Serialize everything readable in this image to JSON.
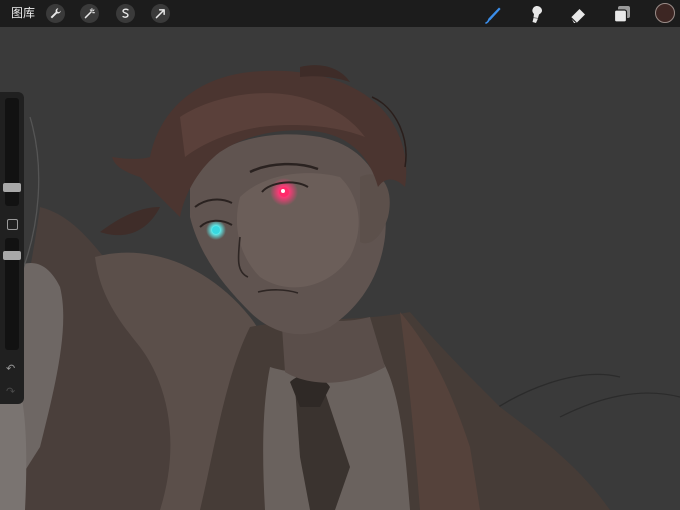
{
  "topbar": {
    "gallery_label": "图库",
    "left_tools": [
      "wrench-icon",
      "magic-wand-icon",
      "selection-icon",
      "transform-arrow-icon"
    ],
    "right_tools": [
      "brush-icon",
      "smudge-icon",
      "eraser-icon",
      "layers-icon",
      "color-swatch"
    ],
    "active_tool": "brush-icon",
    "accent_color": "#3b8eea",
    "current_color": "#3d2623"
  },
  "sidebar": {
    "brush_size_level": 0.55,
    "opacity_level": 0.8,
    "undo_icon": "↶",
    "redo_icon": "↷"
  },
  "canvas": {
    "background_color": "#3a3a3a",
    "artwork": "digital-painting-portrait"
  }
}
